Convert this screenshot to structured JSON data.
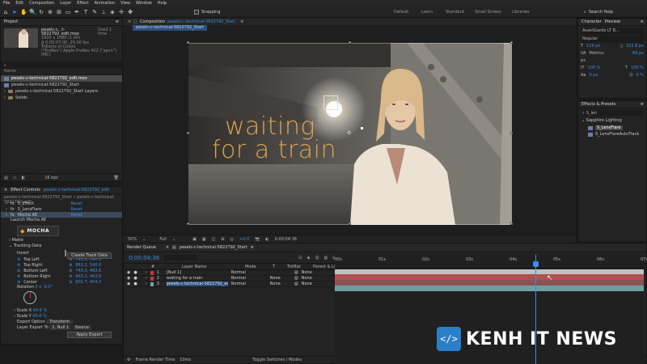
{
  "menu": [
    "File",
    "Edit",
    "Composition",
    "Layer",
    "Effect",
    "Animation",
    "View",
    "Window",
    "Help"
  ],
  "toolbar": {
    "snapping_label": "Snapping",
    "workspaces": [
      "Default",
      "Learn",
      "Standard",
      "Small Screen",
      "Libraries"
    ],
    "search_placeholder": "Search Help"
  },
  "project": {
    "tab": "Project",
    "footage_name": "pexels-c...t-5822792_edit.mov",
    "used_count": "Used 1 time",
    "footage_info": [
      "1920 x 1080 (1.00)",
      "Δ 0:00:07:00, 25.00 fps",
      "Trillions of Colors",
      "(\"ProRes\") Apple ProRes 422 (\"apcn\") (MC)"
    ],
    "items": [
      {
        "name": "pexels-c-technical-5822792_edit.mov",
        "kind": "footage"
      },
      {
        "name": "pexels-c-technical-5822792_Start",
        "kind": "comp"
      },
      {
        "name": "pexels-c-technical-5822792_Start Layers",
        "kind": "folder"
      },
      {
        "name": "Solids",
        "kind": "folder"
      }
    ],
    "bpc": "16 bpc"
  },
  "effect_controls": {
    "tab_prefix": "Effect Controls",
    "tab_layer": "pexels-c-technical-5822792_edit",
    "subtitle": "pexels-c-technical-5822792_Start • pexels-c-technical-5822792_edit",
    "effects": [
      {
        "name": "S_Effect",
        "value": "Reset"
      },
      {
        "name": "S_LensFlare",
        "value": "Reset"
      },
      {
        "name": "Mocha AE",
        "value": "Reset"
      }
    ],
    "launch": "Launch Mocha AE",
    "mocha_logo": "MOCHA",
    "matte": "Matte",
    "tracking_data": "Tracking Data",
    "create_track_btn": "Create Track Data",
    "invert": "Invert",
    "corners": [
      {
        "name": "Top Left",
        "value": "740.2, 540.0"
      },
      {
        "name": "Top Right",
        "value": "863.2, 540.0"
      },
      {
        "name": "Bottom Left",
        "value": "740.2, 463.6"
      },
      {
        "name": "Bottom Right",
        "value": "863.2, 463.6"
      },
      {
        "name": "Center",
        "value": "801.7, 454.3"
      }
    ],
    "rotation_label": "Rotation",
    "rotation_value": "0 x -0.0°",
    "scale_x_label": "Scale X",
    "scale_x_value": "90.6 %",
    "scale_y_label": "Scale Y",
    "scale_y_value": "90.6 %",
    "export_option_label": "Export Option",
    "export_option_value": "Transform",
    "layer_export_label": "Layer Export To",
    "layer_export_value": "1. Null 1",
    "layer_export_source": "Source",
    "apply_export_btn": "Apply Export"
  },
  "composition": {
    "tab_prefix": "Composition",
    "tab_name": "pexels-c-technical-5822792_Start",
    "breadcrumb": "pexels-c-technical-5822792_Start",
    "title_line1": "waiting",
    "title_line2": "for a train",
    "zoom": "50%",
    "resolution": "Full",
    "exposure": "+0.0",
    "timecode": "0:00:04:36"
  },
  "character": {
    "tab": "Character",
    "tab2": "Preview",
    "font": "AvantGarde LT B...",
    "style": "Regular",
    "size": "119 px",
    "leading": "Auto",
    "kerning": "Metrics",
    "tracking": "0",
    "unit": "px",
    "vscale": "100 %",
    "hscale": "100 %",
    "baseline": "0 px",
    "tsume": "0 %",
    "stroke_size": "322.8 px",
    "stroke_val": "89 px"
  },
  "effects_presets": {
    "tab": "Effects & Presets",
    "search": "S_len",
    "category": "Sapphire Lighting",
    "items": [
      {
        "name": "S_LensFlare",
        "selected": true
      },
      {
        "name": "S_LensFlareAutoTrack",
        "selected": false
      }
    ]
  },
  "timeline": {
    "tab_render": "Render Queue",
    "tab_comp": "pexels-c-technical-5822792_Start",
    "timecode": "0;00;04;36",
    "search": "",
    "col_headers": [
      "#",
      "Layer Name",
      "Mode",
      "T",
      "TrkMat",
      "Parent & Link"
    ],
    "layers": [
      {
        "num": "1",
        "name": "[Null 1]",
        "mode": "Normal",
        "trkmat": "",
        "parent": "None",
        "color": "#c23b3b"
      },
      {
        "num": "2",
        "name": "waiting for a train",
        "mode": "Normal",
        "trkmat": "None",
        "parent": "None",
        "color": "#c23b3b"
      },
      {
        "num": "3",
        "name": "pexels-c-technical-5822792_edit",
        "mode": "Normal",
        "trkmat": "None",
        "parent": "None",
        "color": "#6fa7a7"
      }
    ],
    "ruler": [
      "00s",
      "01s",
      "02s",
      "03s",
      "04s",
      "05s",
      "06s",
      "07s"
    ],
    "footer_render": "Frame Render Time",
    "footer_ms": "10ms",
    "footer_toggle": "Toggle Switches / Modes"
  },
  "watermark": "KENH IT NEWS",
  "colors": {
    "accent": "#3a8ee6",
    "text_orange": "#e0a44a",
    "null_bar": "#b05050",
    "video_bar": "#6fa0a0"
  }
}
